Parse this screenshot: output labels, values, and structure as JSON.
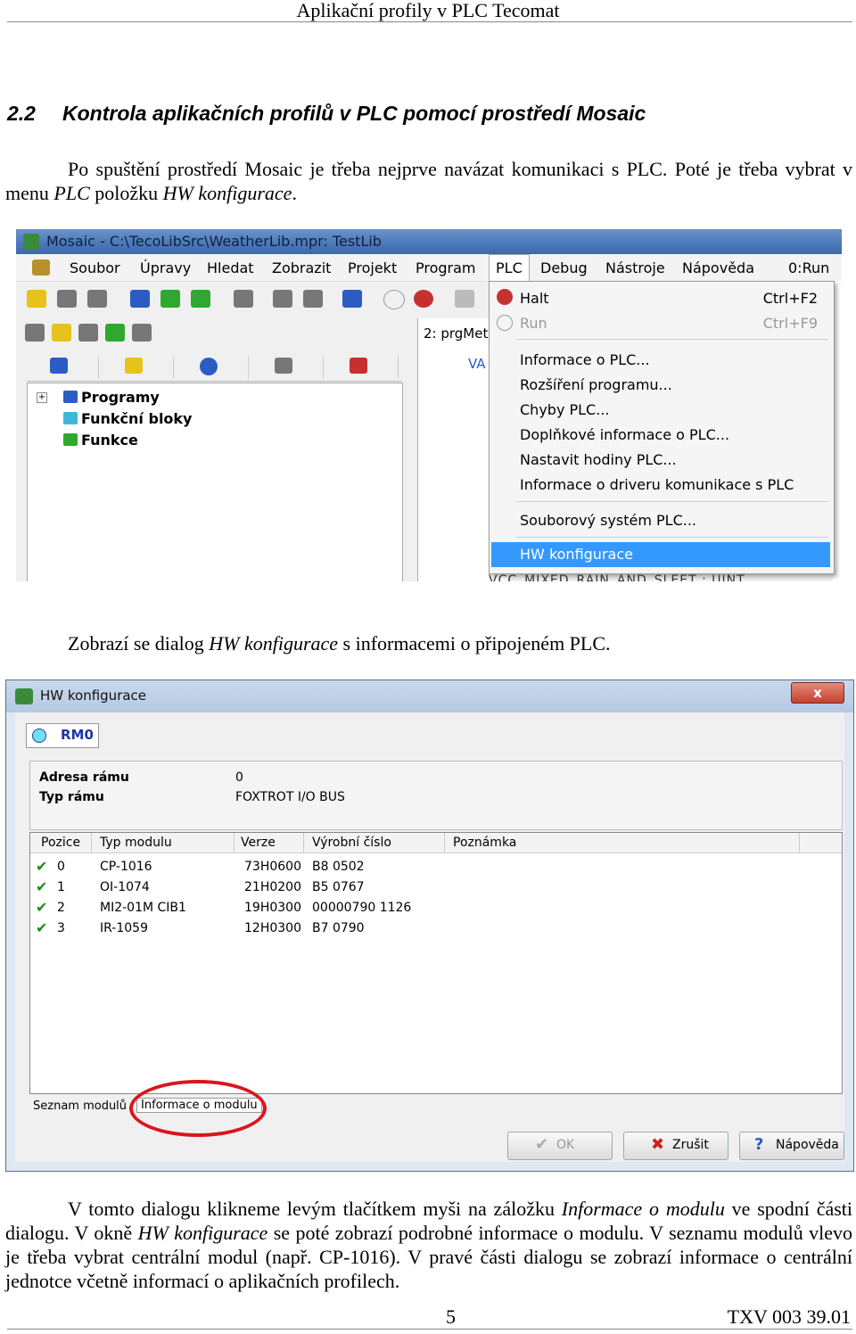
{
  "header": {
    "title": "Aplikační profily v PLC Tecomat"
  },
  "section": {
    "number": "2.2",
    "title": "Kontrola aplikačních profilů v PLC pomocí prostředí Mosaic"
  },
  "para1": {
    "t1": "Po spuštění prostředí Mosaic je třeba nejprve navázat komunikaci s PLC. Poté je třeba",
    "t2": "vybrat v menu ",
    "i1": "PLC",
    "t3": " položku ",
    "i2": "HW konfigurace",
    "t4": "."
  },
  "mosaic": {
    "window_title": "Mosaic - C:\\TecoLibSrc\\WeatherLib.mpr: TestLib",
    "menu": [
      "Soubor",
      "Úpravy",
      "Hledat",
      "Zobrazit",
      "Projekt",
      "Program",
      "PLC",
      "Debug",
      "Nástroje",
      "Nápověda"
    ],
    "status": "0:Run",
    "tree": [
      "Programy",
      "Funkční bloky",
      "Funkce"
    ],
    "editor_tab": "2: prgMet",
    "editor_text": "VA",
    "plc_menu": {
      "halt": "Halt",
      "halt_shortcut": "Ctrl+F2",
      "run": "Run",
      "run_shortcut": "Ctrl+F9",
      "items": [
        "Informace o PLC...",
        "Rozšíření programu...",
        "Chyby PLC...",
        "Doplňkové informace o PLC...",
        "Nastavit hodiny PLC...",
        "Informace o driveru komunikace s PLC"
      ],
      "filesystem": "Souborový systém PLC...",
      "hw": "HW konfigurace"
    },
    "bottom_text": "VCC_MIXED_RAIN_AND_SLEET   : UINT"
  },
  "para2": {
    "t1": "Zobrazí se dialog ",
    "i1": "HW konfigurace",
    "t2": " s informacemi o připojeném PLC."
  },
  "hw_dialog": {
    "title": "HW konfigurace",
    "close": "x",
    "rack_tab": "RM0",
    "rack_address_label": "Adresa rámu",
    "rack_address": "0",
    "rack_type_label": "Typ rámu",
    "rack_type": "FOXTROT I/O BUS",
    "columns": [
      "Pozice",
      "Typ modulu",
      "Verze",
      "Výrobní číslo",
      "Poznámka"
    ],
    "rows": [
      {
        "pos": "0",
        "type": "CP-1016",
        "ver": "73H0600",
        "serial": "B8 0502"
      },
      {
        "pos": "1",
        "type": "OI-1074",
        "ver": "21H0200",
        "serial": "B5 0767"
      },
      {
        "pos": "2",
        "type": "MI2-01M CIB1",
        "ver": "19H0300",
        "serial": "00000790 1126"
      },
      {
        "pos": "3",
        "type": "IR-1059",
        "ver": "12H0300",
        "serial": "B7 0790"
      }
    ],
    "bottom_tabs": [
      "Seznam modulů",
      "Informace o modulu"
    ],
    "buttons": {
      "ok": "OK",
      "cancel": "Zrušit",
      "help": "Nápověda"
    }
  },
  "para3": {
    "t1": "V tomto dialogu klikneme levým tlačítkem myši na záložku ",
    "i1": "Informace o modulu",
    "t2": " ve spodní části dialogu. V okně ",
    "i2": "HW konfigurace",
    "t3": " se poté zobrazí podrobné informace o modulu. V seznamu modulů vlevo je třeba vybrat centrální modul (např. CP-1016). V pravé části dialogu se zobrazí informace o centrální jednotce včetně informací o aplikačních profilech."
  },
  "footer": {
    "page": "5",
    "code": "TXV 003 39.01"
  },
  "colors": {
    "highlight": "#3399ff",
    "circle": "#d9161c",
    "check": "#1c8a1c"
  }
}
